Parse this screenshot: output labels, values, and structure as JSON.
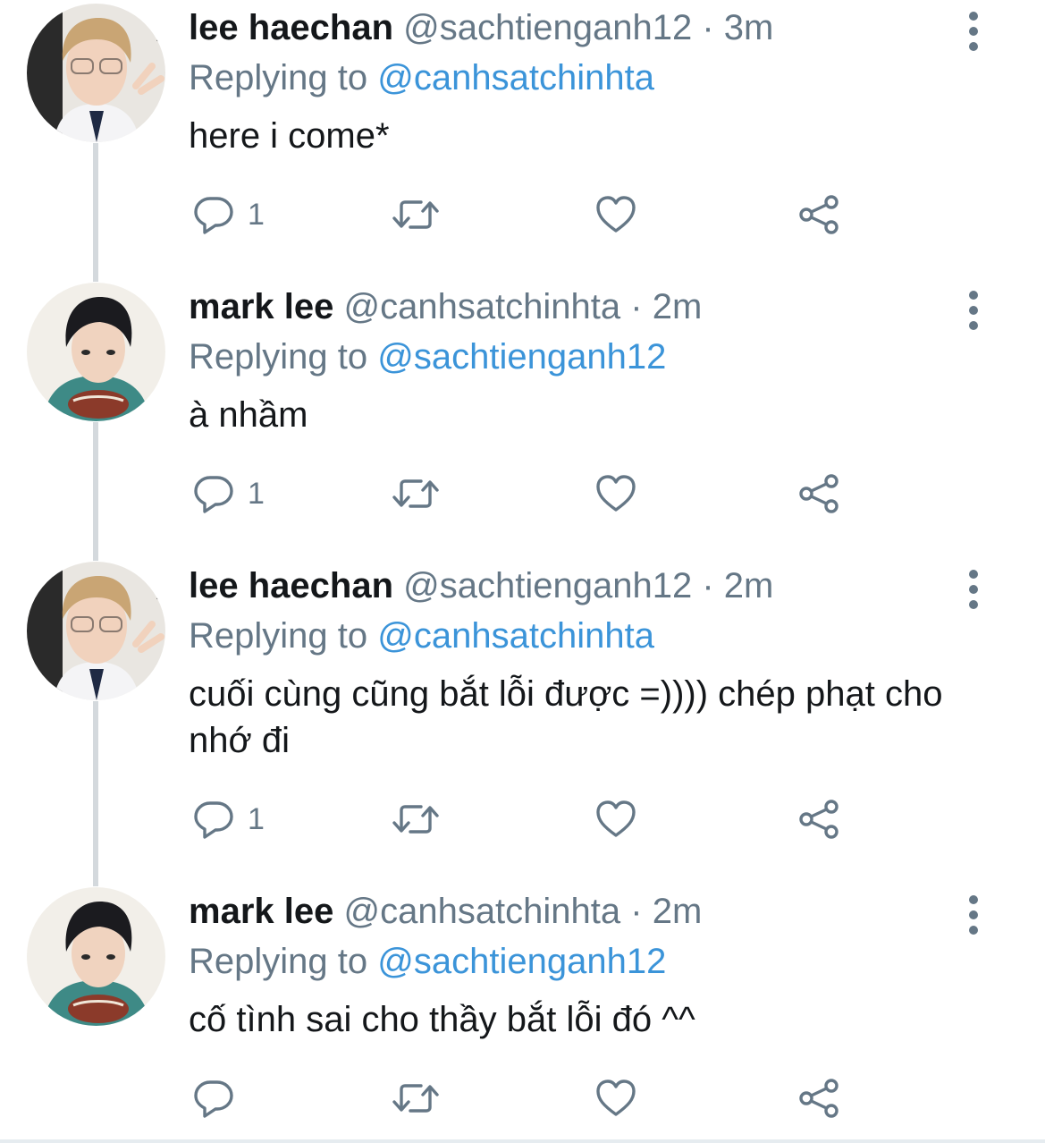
{
  "tweets": [
    {
      "name": "lee haechan",
      "handle": "@sachtienganh12",
      "separator": "·",
      "time": "3m",
      "replying_prefix": "Replying to",
      "replying_to": "@canhsatchinhta",
      "text": "here i come*",
      "reply_count": "1",
      "avatar": "haechan-avatar"
    },
    {
      "name": "mark lee",
      "handle": "@canhsatchinhta",
      "separator": "·",
      "time": "2m",
      "replying_prefix": "Replying to",
      "replying_to": "@sachtienganh12",
      "text": "à nhầm",
      "reply_count": "1",
      "avatar": "mark-avatar"
    },
    {
      "name": "lee haechan",
      "handle": "@sachtienganh12",
      "separator": "·",
      "time": "2m",
      "replying_prefix": "Replying to",
      "replying_to": "@canhsatchinhta",
      "text": "cuối cùng cũng bắt lỗi được =)))) chép phạt cho nhớ đi",
      "reply_count": "1",
      "avatar": "haechan-avatar"
    },
    {
      "name": "mark lee",
      "handle": "@canhsatchinhta",
      "separator": "·",
      "time": "2m",
      "replying_prefix": "Replying to",
      "replying_to": "@sachtienganh12",
      "text": "cố tình sai cho thầy bắt lỗi đó ^^",
      "reply_count": "",
      "avatar": "mark-avatar"
    }
  ],
  "icons": {
    "reply": "reply-icon",
    "retweet": "retweet-icon",
    "like": "heart-icon",
    "share": "share-icon",
    "more": "more-vertical-icon"
  },
  "colors": {
    "name": "#14171a",
    "secondary": "#657786",
    "link": "#3b94d9",
    "thread_line": "#d4d9dd"
  }
}
